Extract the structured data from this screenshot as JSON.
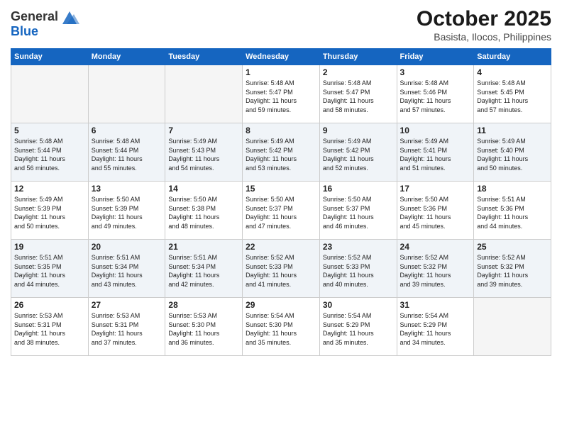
{
  "header": {
    "logo_line1": "General",
    "logo_line2": "Blue",
    "month": "October 2025",
    "location": "Basista, Ilocos, Philippines"
  },
  "weekdays": [
    "Sunday",
    "Monday",
    "Tuesday",
    "Wednesday",
    "Thursday",
    "Friday",
    "Saturday"
  ],
  "weeks": [
    [
      {
        "day": "",
        "sunrise": "",
        "sunset": "",
        "daylight": ""
      },
      {
        "day": "",
        "sunrise": "",
        "sunset": "",
        "daylight": ""
      },
      {
        "day": "",
        "sunrise": "",
        "sunset": "",
        "daylight": ""
      },
      {
        "day": "1",
        "sunrise": "Sunrise: 5:48 AM",
        "sunset": "Sunset: 5:47 PM",
        "daylight": "Daylight: 11 hours and 59 minutes."
      },
      {
        "day": "2",
        "sunrise": "Sunrise: 5:48 AM",
        "sunset": "Sunset: 5:47 PM",
        "daylight": "Daylight: 11 hours and 58 minutes."
      },
      {
        "day": "3",
        "sunrise": "Sunrise: 5:48 AM",
        "sunset": "Sunset: 5:46 PM",
        "daylight": "Daylight: 11 hours and 57 minutes."
      },
      {
        "day": "4",
        "sunrise": "Sunrise: 5:48 AM",
        "sunset": "Sunset: 5:45 PM",
        "daylight": "Daylight: 11 hours and 57 minutes."
      }
    ],
    [
      {
        "day": "5",
        "sunrise": "Sunrise: 5:48 AM",
        "sunset": "Sunset: 5:44 PM",
        "daylight": "Daylight: 11 hours and 56 minutes."
      },
      {
        "day": "6",
        "sunrise": "Sunrise: 5:48 AM",
        "sunset": "Sunset: 5:44 PM",
        "daylight": "Daylight: 11 hours and 55 minutes."
      },
      {
        "day": "7",
        "sunrise": "Sunrise: 5:49 AM",
        "sunset": "Sunset: 5:43 PM",
        "daylight": "Daylight: 11 hours and 54 minutes."
      },
      {
        "day": "8",
        "sunrise": "Sunrise: 5:49 AM",
        "sunset": "Sunset: 5:42 PM",
        "daylight": "Daylight: 11 hours and 53 minutes."
      },
      {
        "day": "9",
        "sunrise": "Sunrise: 5:49 AM",
        "sunset": "Sunset: 5:42 PM",
        "daylight": "Daylight: 11 hours and 52 minutes."
      },
      {
        "day": "10",
        "sunrise": "Sunrise: 5:49 AM",
        "sunset": "Sunset: 5:41 PM",
        "daylight": "Daylight: 11 hours and 51 minutes."
      },
      {
        "day": "11",
        "sunrise": "Sunrise: 5:49 AM",
        "sunset": "Sunset: 5:40 PM",
        "daylight": "Daylight: 11 hours and 50 minutes."
      }
    ],
    [
      {
        "day": "12",
        "sunrise": "Sunrise: 5:49 AM",
        "sunset": "Sunset: 5:39 PM",
        "daylight": "Daylight: 11 hours and 50 minutes."
      },
      {
        "day": "13",
        "sunrise": "Sunrise: 5:50 AM",
        "sunset": "Sunset: 5:39 PM",
        "daylight": "Daylight: 11 hours and 49 minutes."
      },
      {
        "day": "14",
        "sunrise": "Sunrise: 5:50 AM",
        "sunset": "Sunset: 5:38 PM",
        "daylight": "Daylight: 11 hours and 48 minutes."
      },
      {
        "day": "15",
        "sunrise": "Sunrise: 5:50 AM",
        "sunset": "Sunset: 5:37 PM",
        "daylight": "Daylight: 11 hours and 47 minutes."
      },
      {
        "day": "16",
        "sunrise": "Sunrise: 5:50 AM",
        "sunset": "Sunset: 5:37 PM",
        "daylight": "Daylight: 11 hours and 46 minutes."
      },
      {
        "day": "17",
        "sunrise": "Sunrise: 5:50 AM",
        "sunset": "Sunset: 5:36 PM",
        "daylight": "Daylight: 11 hours and 45 minutes."
      },
      {
        "day": "18",
        "sunrise": "Sunrise: 5:51 AM",
        "sunset": "Sunset: 5:36 PM",
        "daylight": "Daylight: 11 hours and 44 minutes."
      }
    ],
    [
      {
        "day": "19",
        "sunrise": "Sunrise: 5:51 AM",
        "sunset": "Sunset: 5:35 PM",
        "daylight": "Daylight: 11 hours and 44 minutes."
      },
      {
        "day": "20",
        "sunrise": "Sunrise: 5:51 AM",
        "sunset": "Sunset: 5:34 PM",
        "daylight": "Daylight: 11 hours and 43 minutes."
      },
      {
        "day": "21",
        "sunrise": "Sunrise: 5:51 AM",
        "sunset": "Sunset: 5:34 PM",
        "daylight": "Daylight: 11 hours and 42 minutes."
      },
      {
        "day": "22",
        "sunrise": "Sunrise: 5:52 AM",
        "sunset": "Sunset: 5:33 PM",
        "daylight": "Daylight: 11 hours and 41 minutes."
      },
      {
        "day": "23",
        "sunrise": "Sunrise: 5:52 AM",
        "sunset": "Sunset: 5:33 PM",
        "daylight": "Daylight: 11 hours and 40 minutes."
      },
      {
        "day": "24",
        "sunrise": "Sunrise: 5:52 AM",
        "sunset": "Sunset: 5:32 PM",
        "daylight": "Daylight: 11 hours and 39 minutes."
      },
      {
        "day": "25",
        "sunrise": "Sunrise: 5:52 AM",
        "sunset": "Sunset: 5:32 PM",
        "daylight": "Daylight: 11 hours and 39 minutes."
      }
    ],
    [
      {
        "day": "26",
        "sunrise": "Sunrise: 5:53 AM",
        "sunset": "Sunset: 5:31 PM",
        "daylight": "Daylight: 11 hours and 38 minutes."
      },
      {
        "day": "27",
        "sunrise": "Sunrise: 5:53 AM",
        "sunset": "Sunset: 5:31 PM",
        "daylight": "Daylight: 11 hours and 37 minutes."
      },
      {
        "day": "28",
        "sunrise": "Sunrise: 5:53 AM",
        "sunset": "Sunset: 5:30 PM",
        "daylight": "Daylight: 11 hours and 36 minutes."
      },
      {
        "day": "29",
        "sunrise": "Sunrise: 5:54 AM",
        "sunset": "Sunset: 5:30 PM",
        "daylight": "Daylight: 11 hours and 35 minutes."
      },
      {
        "day": "30",
        "sunrise": "Sunrise: 5:54 AM",
        "sunset": "Sunset: 5:29 PM",
        "daylight": "Daylight: 11 hours and 35 minutes."
      },
      {
        "day": "31",
        "sunrise": "Sunrise: 5:54 AM",
        "sunset": "Sunset: 5:29 PM",
        "daylight": "Daylight: 11 hours and 34 minutes."
      },
      {
        "day": "",
        "sunrise": "",
        "sunset": "",
        "daylight": ""
      }
    ]
  ]
}
